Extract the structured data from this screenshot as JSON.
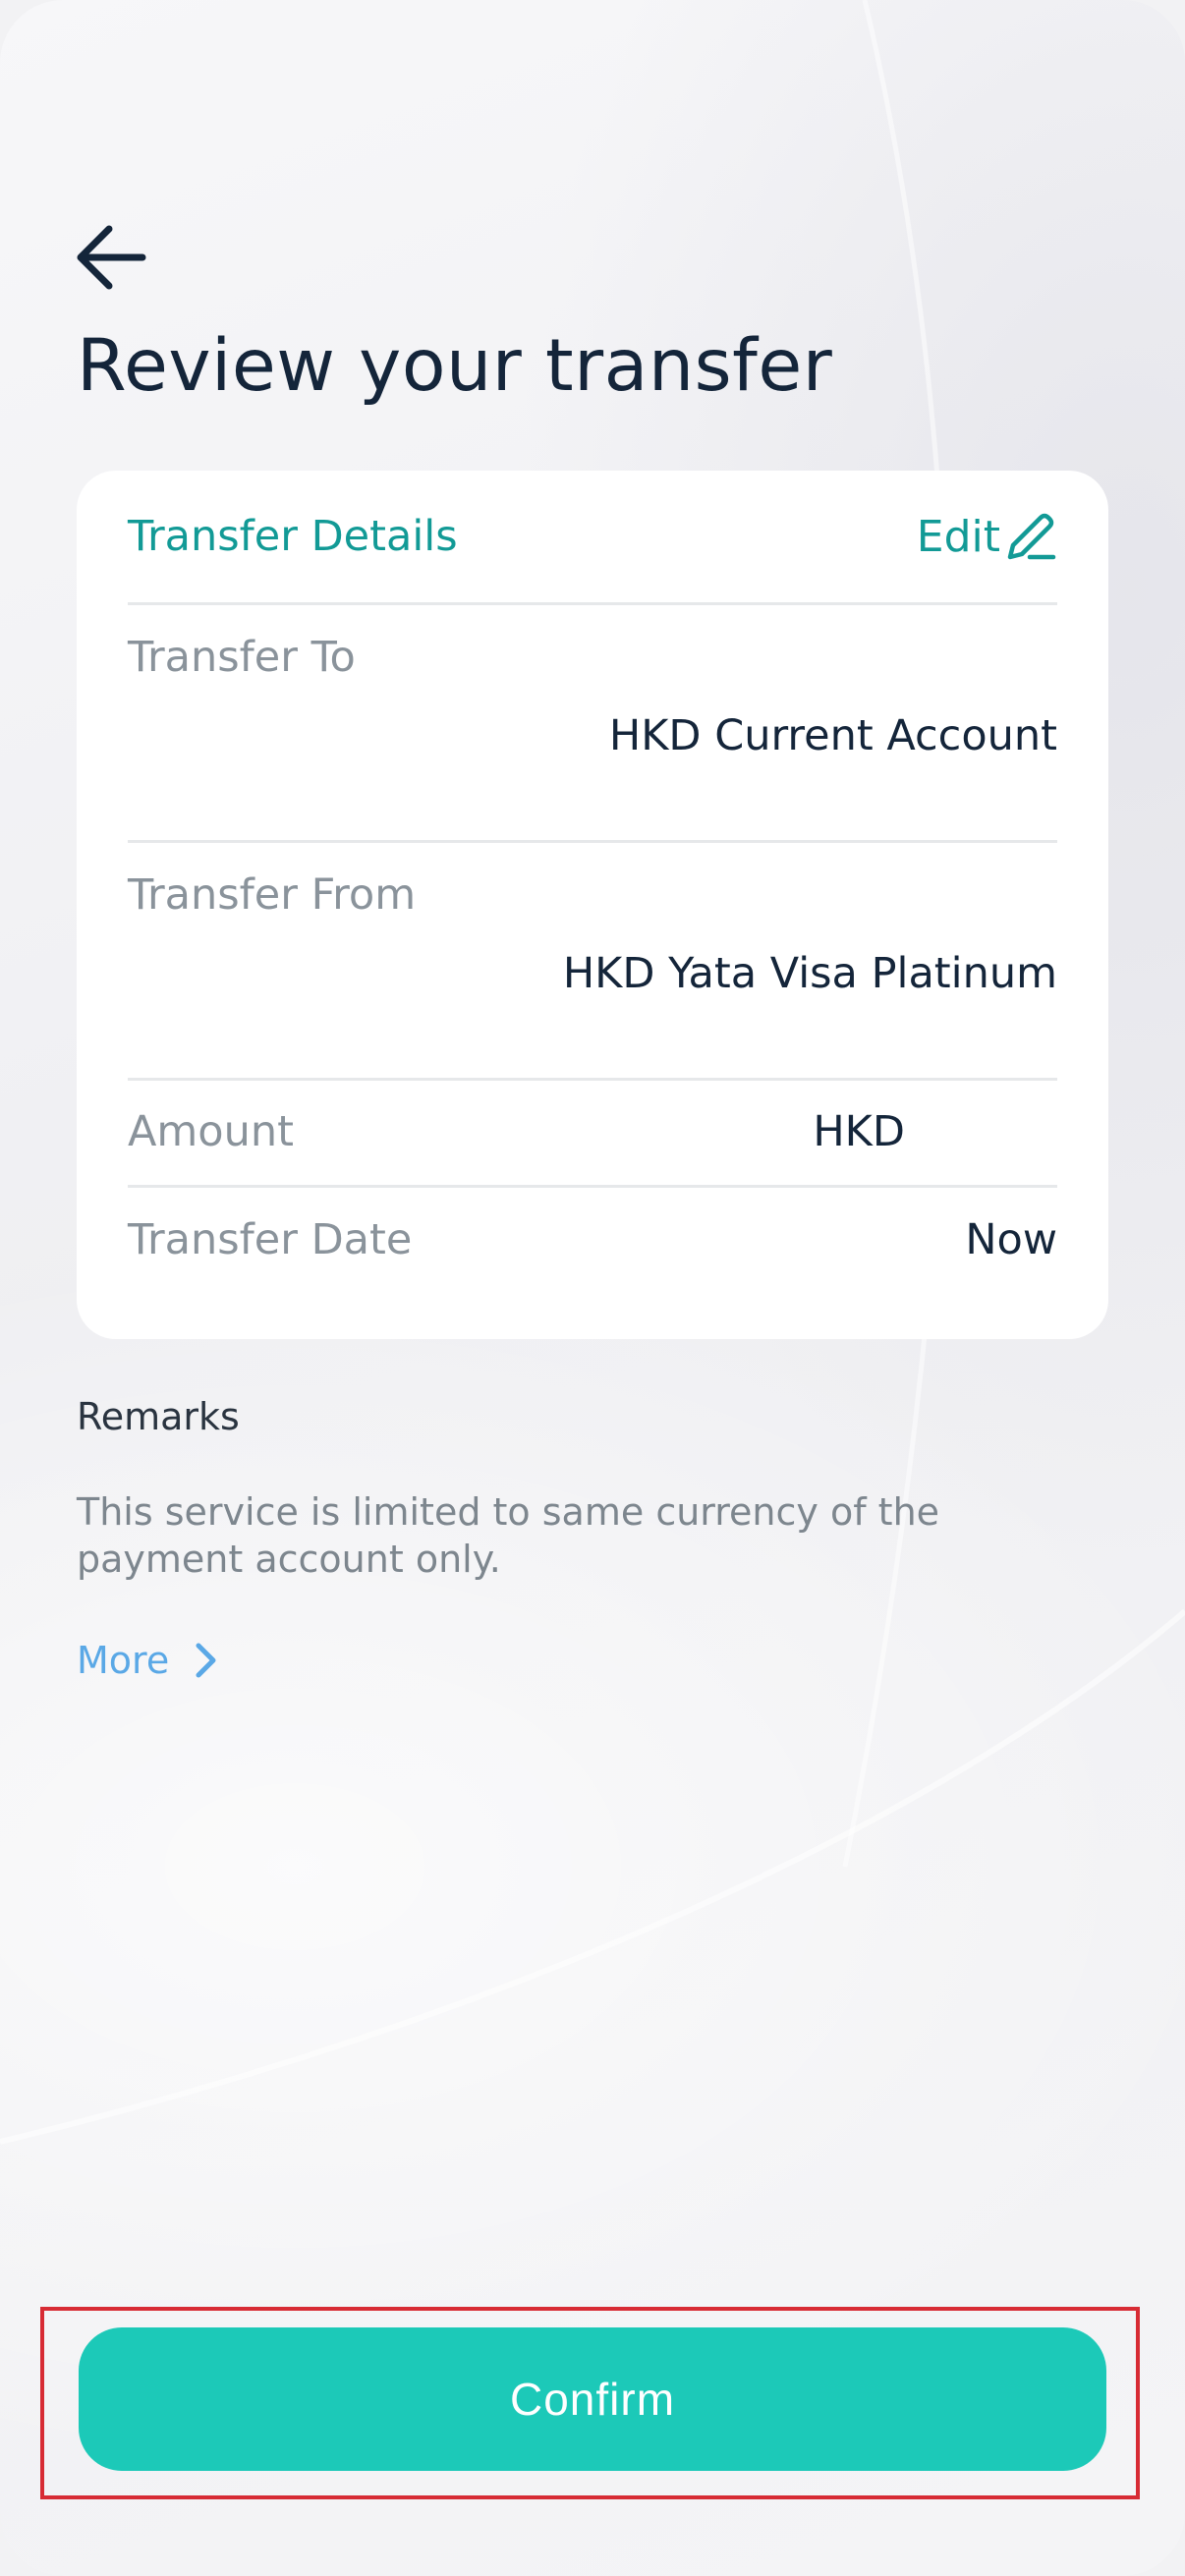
{
  "header": {
    "back_icon": "arrow-left-icon",
    "title": "Review your transfer"
  },
  "transfer_card": {
    "title": "Transfer Details",
    "edit_label": "Edit",
    "edit_icon": "pencil-icon",
    "rows": [
      {
        "label": "Transfer To",
        "value": "HKD Current Account"
      },
      {
        "label": "Transfer From",
        "value": "HKD Yata Visa Platinum"
      },
      {
        "label": "Amount",
        "value": "HKD"
      },
      {
        "label": "Transfer Date",
        "value": "Now"
      }
    ]
  },
  "remarks": {
    "title": "Remarks",
    "text": "This service is limited to same currency of the payment account only.",
    "more_label": "More",
    "more_icon": "chevron-right-icon"
  },
  "footer": {
    "confirm_label": "Confirm"
  },
  "colors": {
    "accent": "#129a96",
    "confirm_button": "#1cc9b8",
    "link": "#5aa8e6",
    "highlight_outline": "#d72b34"
  }
}
